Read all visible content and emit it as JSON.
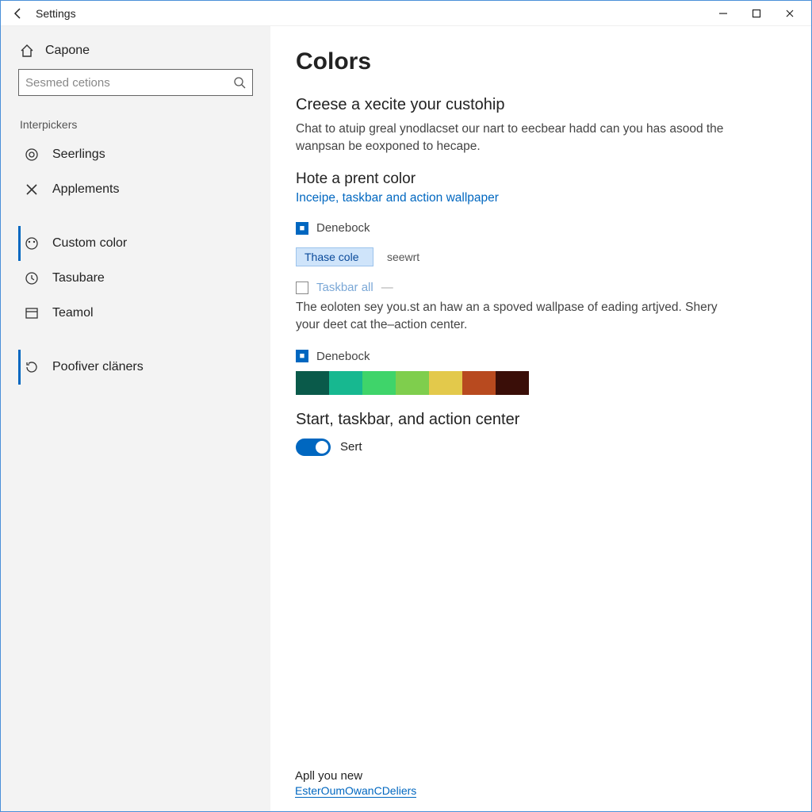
{
  "window": {
    "title": "Settings"
  },
  "sidebar": {
    "home": "Capone",
    "search_placeholder": "Sesmed cetions",
    "section1_header": "Interpickers",
    "group1": [
      {
        "label": "Seerlings"
      },
      {
        "label": "Applements"
      }
    ],
    "group2": [
      {
        "label": "Custom color"
      },
      {
        "label": "Tasubare"
      },
      {
        "label": "Teamol"
      }
    ],
    "group3": [
      {
        "label": "Poofiver cläners"
      }
    ]
  },
  "main": {
    "heading": "Colors",
    "subheading": "Creese a xecite your custohip",
    "description": "Chat to atuip greal ynodlacset our nart to eecbear hadd can you has asood the wanpsan be eoxponed to hecape.",
    "accent_heading": "Hote a prent color",
    "accent_link": "Inceipe, taskbar and action wallpaper",
    "check1": "Denebock",
    "chip_label": "Thase cole",
    "chip_aside": "seewrt",
    "check2_label": "Taskbar all",
    "check2_aside": "—",
    "para2": "The eoloten sey you.st an haw an a spoved wallpase of eading artjved. Shery your deet cat the–action center.",
    "check3": "Denebock",
    "swatches": [
      "#0a5a4a",
      "#17b890",
      "#3fd46a",
      "#7fce4d",
      "#e3c94b",
      "#b84a1f",
      "#3a0e08"
    ],
    "section2_heading": "Start,  taskbar, and action center",
    "toggle_label": "Sert",
    "footer_text": "Apll you new",
    "footer_link": "EsterOumOwanCDeliers"
  }
}
